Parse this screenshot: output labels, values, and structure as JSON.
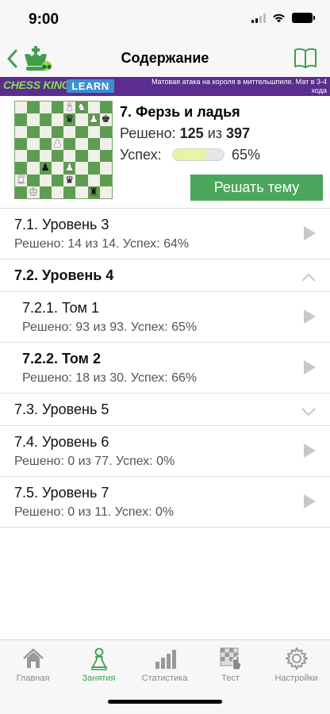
{
  "status_bar": {
    "time": "9:00"
  },
  "navbar": {
    "title": "Содержание",
    "back_icon": "chevron-left-icon",
    "logo_icon": "chess-king-logo-icon",
    "book_icon": "book-icon"
  },
  "banner": {
    "logo_text": "CHESS KING",
    "learn_text": "LEARN",
    "course_text": "Матовая атака на короля в миттельшпиле. Мат в 3-4 хода"
  },
  "theme": {
    "title": "7. Ферзь и ладья",
    "solved_label": "Решено:",
    "solved_count": "125",
    "solved_of": "из",
    "solved_total": "397",
    "success_label": "Успех:",
    "success_value": 0.65,
    "success_pct": "65%",
    "solve_button": "Решать тему"
  },
  "board": {
    "light_color": "#f0f0e6",
    "dark_color": "#5e9c53",
    "squares": [
      "",
      "",
      "",
      "",
      "wB",
      "wN",
      "",
      "",
      "",
      "",
      "",
      "",
      "bQ",
      "",
      "wP",
      "bK",
      "",
      "",
      "",
      "",
      "",
      "",
      "",
      "",
      "",
      "",
      "",
      "wP",
      "",
      "",
      "",
      "",
      "",
      "",
      "",
      "",
      "",
      "",
      "",
      "",
      "",
      "",
      "bP",
      "",
      "wP",
      "",
      "",
      "",
      "wR",
      "",
      "",
      "",
      "bQ",
      "",
      "",
      "",
      "",
      "wK",
      "",
      "",
      "",
      "",
      "bR",
      ""
    ]
  },
  "list": [
    {
      "title": "7.1. Уровень 3",
      "subtitle": "Решено: 14 из 14. Успех: 64%",
      "bold": false,
      "level": 0,
      "icon": "play-arrow-icon"
    },
    {
      "title": "7.2. Уровень 4",
      "subtitle": "",
      "bold": true,
      "level": 0,
      "icon": "chevron-up-icon"
    },
    {
      "title": "7.2.1. Том 1",
      "subtitle": "Решено: 93 из 93. Успех: 65%",
      "bold": false,
      "level": 1,
      "icon": "play-arrow-icon"
    },
    {
      "title": "7.2.2. Том 2",
      "subtitle": "Решено: 18 из 30. Успех: 66%",
      "bold": true,
      "level": 1,
      "icon": "play-arrow-icon"
    },
    {
      "title": "7.3. Уровень 5",
      "subtitle": "",
      "bold": false,
      "level": 0,
      "icon": "chevron-down-icon"
    },
    {
      "title": "7.4. Уровень 6",
      "subtitle": "Решено: 0 из 77. Успех: 0%",
      "bold": false,
      "level": 0,
      "icon": "play-arrow-icon"
    },
    {
      "title": "7.5. Уровень 7",
      "subtitle": "Решено: 0 из 11. Успех: 0%",
      "bold": false,
      "level": 0,
      "icon": "play-arrow-icon"
    }
  ],
  "tabbar": {
    "tabs": [
      {
        "label": "Главная",
        "icon": "home-icon",
        "active": false
      },
      {
        "label": "Занятия",
        "icon": "pawn-icon",
        "active": true
      },
      {
        "label": "Статистика",
        "icon": "bar-chart-icon",
        "active": false
      },
      {
        "label": "Тест",
        "icon": "chessboard-hand-icon",
        "active": false
      },
      {
        "label": "Настройки",
        "icon": "gear-icon",
        "active": false
      }
    ]
  },
  "colors": {
    "accent": "#3f9e4c",
    "banner": "#5b2d8e",
    "button": "#4aa65a",
    "progress": "#e9f3a4"
  }
}
